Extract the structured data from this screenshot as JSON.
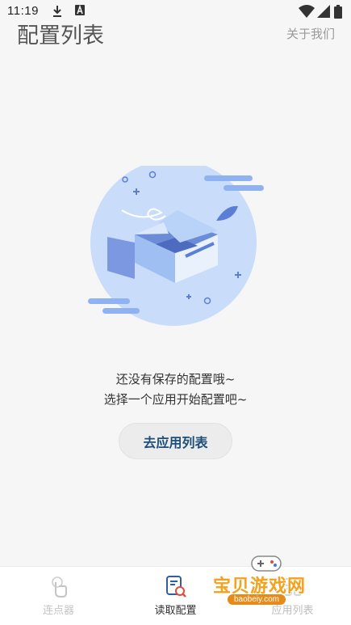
{
  "status_bar": {
    "time": "11:19",
    "icons": [
      "download-icon",
      "a-badge-icon",
      "wifi-icon",
      "signal-icon",
      "battery-icon"
    ]
  },
  "header": {
    "title": "配置列表",
    "about_label": "关于我们"
  },
  "empty_state": {
    "line1": "还没有保存的配置哦~",
    "line2": "选择一个应用开始配置吧~",
    "button_label": "去应用列表"
  },
  "bottom_nav": {
    "items": [
      {
        "label": "连点器",
        "icon": "tap-hand-icon",
        "active": false
      },
      {
        "label": "读取配置",
        "icon": "read-config-icon",
        "active": true
      },
      {
        "label": "应用列表",
        "icon": "app-list-icon",
        "active": false
      }
    ]
  },
  "watermark": {
    "text": "宝贝游戏网",
    "url": "baobeiy.com"
  },
  "colors": {
    "accent": "#1d4f7a",
    "illustration_light": "#c9dcfa",
    "illustration_mid": "#a9c8f5",
    "illustration_dark": "#5b7fd6",
    "active_icon": "#2f5f9e",
    "active_icon_secondary": "#e24a3a"
  }
}
